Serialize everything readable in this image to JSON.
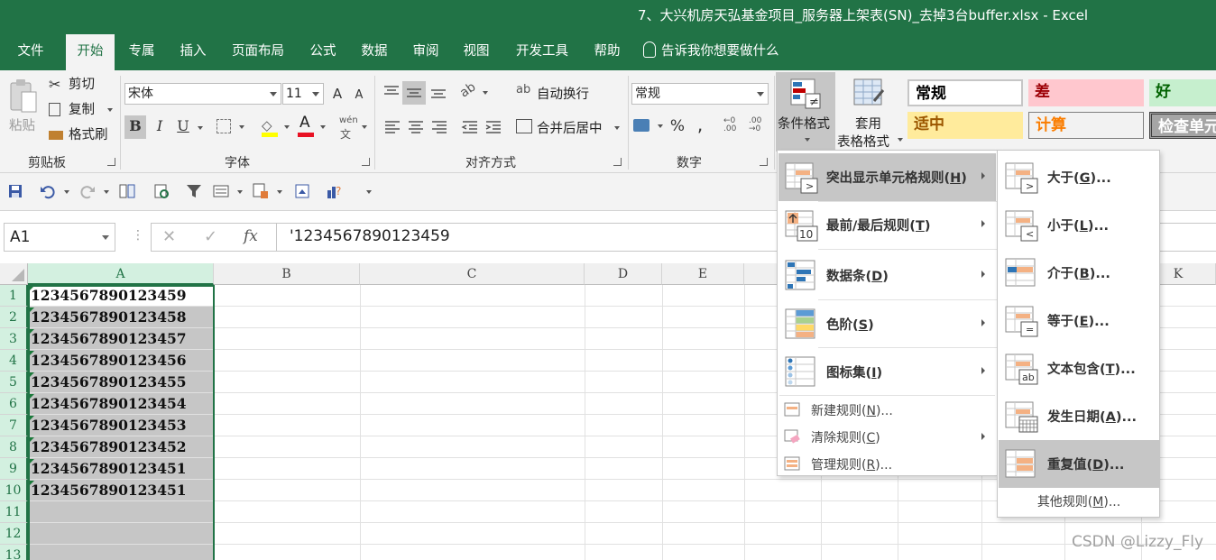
{
  "window": {
    "title": "7、大兴机房天弘基金项目_服务器上架表(SN)_去掉3台buffer.xlsx  -  Excel"
  },
  "tabs": [
    {
      "label": "文件"
    },
    {
      "label": "开始"
    },
    {
      "label": "专属"
    },
    {
      "label": "插入"
    },
    {
      "label": "页面布局"
    },
    {
      "label": "公式"
    },
    {
      "label": "数据"
    },
    {
      "label": "审阅"
    },
    {
      "label": "视图"
    },
    {
      "label": "开发工具"
    },
    {
      "label": "帮助"
    }
  ],
  "tell_me": "告诉我你想要做什么",
  "ribbon": {
    "clipboard": {
      "paste": "粘贴",
      "cut": "剪切",
      "copy": "复制",
      "format_painter": "格式刷",
      "group": "剪贴板"
    },
    "font": {
      "name": "宋体",
      "size": "11",
      "grow": "A",
      "shrink": "A",
      "bold": "B",
      "italic": "I",
      "underline": "U",
      "font_color_glyph": "A",
      "wen": "wén",
      "group": "字体"
    },
    "alignment": {
      "wrap": "自动换行",
      "merge": "合并后居中",
      "group": "对齐方式"
    },
    "number": {
      "format": "常规",
      "percent": "%",
      "comma": ",",
      "group": "数字"
    },
    "styles": {
      "conditional": "条件格式",
      "table_line1": "套用",
      "table_line2": "表格格式",
      "cells": [
        {
          "label": "常规",
          "bg": "#ffffff",
          "color": "#000000"
        },
        {
          "label": "差",
          "bg": "#ffc7ce",
          "color": "#9c0006"
        },
        {
          "label": "好",
          "bg": "#c6efce",
          "color": "#006100"
        },
        {
          "label": "适中",
          "bg": "#ffeb9c",
          "color": "#9c5700"
        },
        {
          "label": "计算",
          "bg": "#f2f2f2",
          "color": "#fa7d00"
        },
        {
          "label": "检查单元",
          "bg": "#a5a5a5",
          "color": "#ffffff"
        }
      ]
    }
  },
  "formula_bar": {
    "name_box": "A1",
    "cancel": "✕",
    "enter": "✓",
    "fx": "fx",
    "value": "'1234567890123459"
  },
  "columns": [
    "A",
    "B",
    "C",
    "D",
    "E",
    "K"
  ],
  "rows": [
    "1",
    "2",
    "3",
    "4",
    "5",
    "6",
    "7",
    "8",
    "9",
    "10",
    "11",
    "12",
    "13"
  ],
  "cells_A": [
    "1234567890123459",
    "1234567890123458",
    "1234567890123457",
    "1234567890123456",
    "1234567890123455",
    "1234567890123454",
    "1234567890123453",
    "1234567890123452",
    "1234567890123451",
    "1234567890123451"
  ],
  "cf_menu": {
    "items": [
      {
        "label": "突出显示单元格规则(",
        "key": "H",
        "tail": ")"
      },
      {
        "label": "最前/最后规则(",
        "key": "T",
        "tail": ")"
      },
      {
        "label": "数据条(",
        "key": "D",
        "tail": ")"
      },
      {
        "label": "色阶(",
        "key": "S",
        "tail": ")"
      },
      {
        "label": "图标集(",
        "key": "I",
        "tail": ")"
      }
    ],
    "small_items": [
      {
        "label": "新建规则(",
        "key": "N",
        "tail": ")..."
      },
      {
        "label": "清除规则(",
        "key": "C",
        "tail": ")"
      },
      {
        "label": "管理规则(",
        "key": "R",
        "tail": ")..."
      }
    ],
    "top10_badge": "10"
  },
  "submenu": {
    "items": [
      {
        "label": "大于(",
        "key": "G",
        "tail": ")..."
      },
      {
        "label": "小于(",
        "key": "L",
        "tail": ")..."
      },
      {
        "label": "介于(",
        "key": "B",
        "tail": ")..."
      },
      {
        "label": "等于(",
        "key": "E",
        "tail": ")..."
      },
      {
        "label": "文本包含(",
        "key": "T",
        "tail": ")..."
      },
      {
        "label": "发生日期(",
        "key": "A",
        "tail": ")..."
      },
      {
        "label": "重复值(",
        "key": "D",
        "tail": ")..."
      }
    ],
    "other": {
      "label": "其他规则(",
      "key": "M",
      "tail": ")..."
    },
    "glyphs": {
      "gt": ">",
      "lt": "<",
      "eq": "=",
      "ab": "ab"
    }
  },
  "watermark": "CSDN @Lizzy_Fly",
  "accent": "#217346"
}
